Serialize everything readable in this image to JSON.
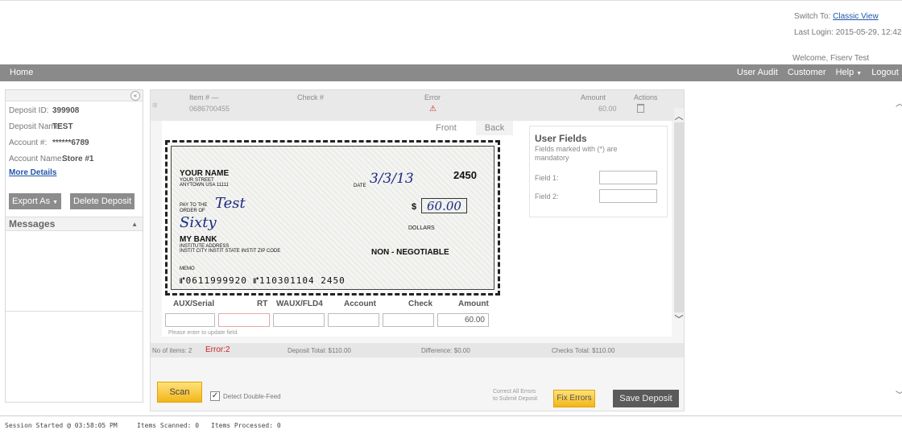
{
  "header": {
    "switch_to_label": "Switch To:",
    "switch_to_link": "Classic View",
    "last_login": "Last Login: 2015-05-29, 12:42",
    "welcome": "Welcome, Fiserv Test"
  },
  "nav": {
    "home": "Home",
    "items": [
      "User Audit",
      "Customer",
      "Help",
      "Logout"
    ],
    "help_has_dropdown": true
  },
  "deposit": {
    "fields": [
      {
        "label": "Deposit ID:",
        "value": "399908"
      },
      {
        "label": "Deposit Name:",
        "value": "TEST"
      },
      {
        "label": "Account #:",
        "value": "******6789"
      },
      {
        "label": "Account Name:",
        "value": "Store #1"
      }
    ],
    "more_details": "More Details",
    "export_as": "Export As",
    "delete_deposit": "Delete Deposit"
  },
  "messages": {
    "title": "Messages"
  },
  "item": {
    "col_item": "Item # —",
    "col_check": "Check #",
    "col_error": "Error",
    "col_amount": "Amount",
    "col_actions": "Actions",
    "item_number": "0686700455",
    "amount": "60.00",
    "error_icon": "warning-triangle-icon"
  },
  "tabs": {
    "front": "Front",
    "back": "Back"
  },
  "check": {
    "payer_name": "YOUR NAME",
    "payer_street": "YOUR STREET",
    "payer_city": "ANYTOWN USA 11111",
    "date_label": "DATE",
    "date_value": "3/3/13",
    "check_number": "2450",
    "pay_to_label": "PAY TO THE ORDER OF",
    "payee": "Test",
    "dollar_sign": "$",
    "amount_numeric": "60.00",
    "amount_words": "Sixty",
    "dollars_label": "DOLLARS",
    "bank_name": "MY BANK",
    "bank_address": "INSTITUTE ADDRESS",
    "bank_city": "INSTIT CITY INSTIT STATE INSTIT ZIP CODE",
    "non_negotiable": "NON - NEGOTIABLE",
    "memo_label": "MEMO",
    "micr_line": "⑈0611999920  ⑈110301104  2450"
  },
  "user_fields": {
    "title": "User Fields",
    "note": "Fields marked with (*) are mandatory",
    "field1_label": "Field 1:",
    "field2_label": "Field 2:"
  },
  "micr": {
    "headers": [
      "AUX/Serial",
      "RT",
      "WAUX/FLD4",
      "Account",
      "Check",
      "Amount"
    ],
    "amount_value": "60.00",
    "hint": "Please enter to update field."
  },
  "summary": {
    "items": "No of items: 2",
    "errors": "Error:2",
    "deposit_total": "Deposit Total: $110.00",
    "difference": "Difference: $0.00",
    "checks_total": "Checks Total: $110.00"
  },
  "actions": {
    "scan": "Scan",
    "detect_double_feed": "Detect Double-Feed",
    "detect_double_feed_checked": true,
    "correct_note_line1": "Correct All Errors",
    "correct_note_line2": "to Submit Deposit",
    "fix_errors": "Fix Errors",
    "save_deposit": "Save Deposit"
  },
  "status": {
    "session": "Session Started @ 03:58:05 PM",
    "scanned": "Items Scanned: 0",
    "processed": "Items Processed: 0"
  },
  "colors": {
    "nav_bg": "#8a8a8a",
    "accent_yellow": "#f2b51b",
    "link_blue": "#2255aa",
    "error_red": "#cc2222"
  }
}
